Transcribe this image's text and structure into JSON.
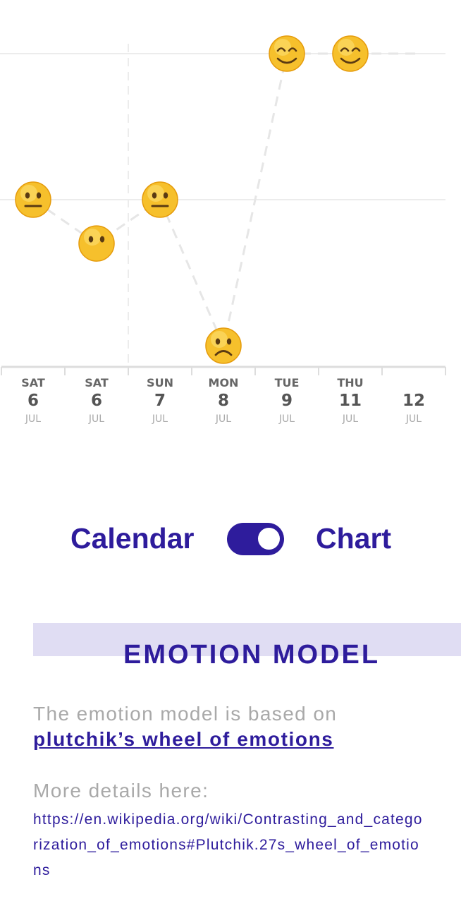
{
  "chart_data": {
    "type": "line",
    "x": [
      {
        "day": "SAT",
        "date": "6",
        "month": "JUL"
      },
      {
        "day": "SAT",
        "date": "6",
        "month": "JUL"
      },
      {
        "day": "SUN",
        "date": "7",
        "month": "JUL"
      },
      {
        "day": "MON",
        "date": "8",
        "month": "JUL"
      },
      {
        "day": "TUE",
        "date": "9",
        "month": "JUL"
      },
      {
        "day": "THU",
        "date": "11",
        "month": "JUL"
      },
      {
        "day": "",
        "date": "12",
        "month": "JUL"
      }
    ],
    "series": [
      {
        "values": [
          0,
          -0.3,
          0,
          -1,
          1,
          1,
          null
        ],
        "markers": [
          "neutral",
          "no-mouth",
          "neutral",
          "frowning",
          "smiling",
          "smiling",
          null
        ]
      }
    ],
    "ylim": [
      -1,
      1
    ],
    "grid": "horizontal",
    "line_style": "dashed",
    "colors": {
      "line": "#e6e6e6",
      "grid": "#ececec",
      "axis": "#dddddd",
      "face": "#f6c02c"
    }
  },
  "view_toggle": {
    "left_label": "Calendar",
    "right_label": "Chart",
    "state": "chart",
    "color": "#2e1c9c"
  },
  "section": {
    "title": "EMOTION MODEL",
    "band_color": "#e0ddf3"
  },
  "model": {
    "intro": "The emotion model is based on",
    "link_text": "plutchik’s wheel of emotions",
    "details_label": "More details here:",
    "details_url": "https://en.wikipedia.org/wiki/Contrasting_and_categorization_of_emotions#Plutchik.27s_wheel_of_emotions"
  }
}
